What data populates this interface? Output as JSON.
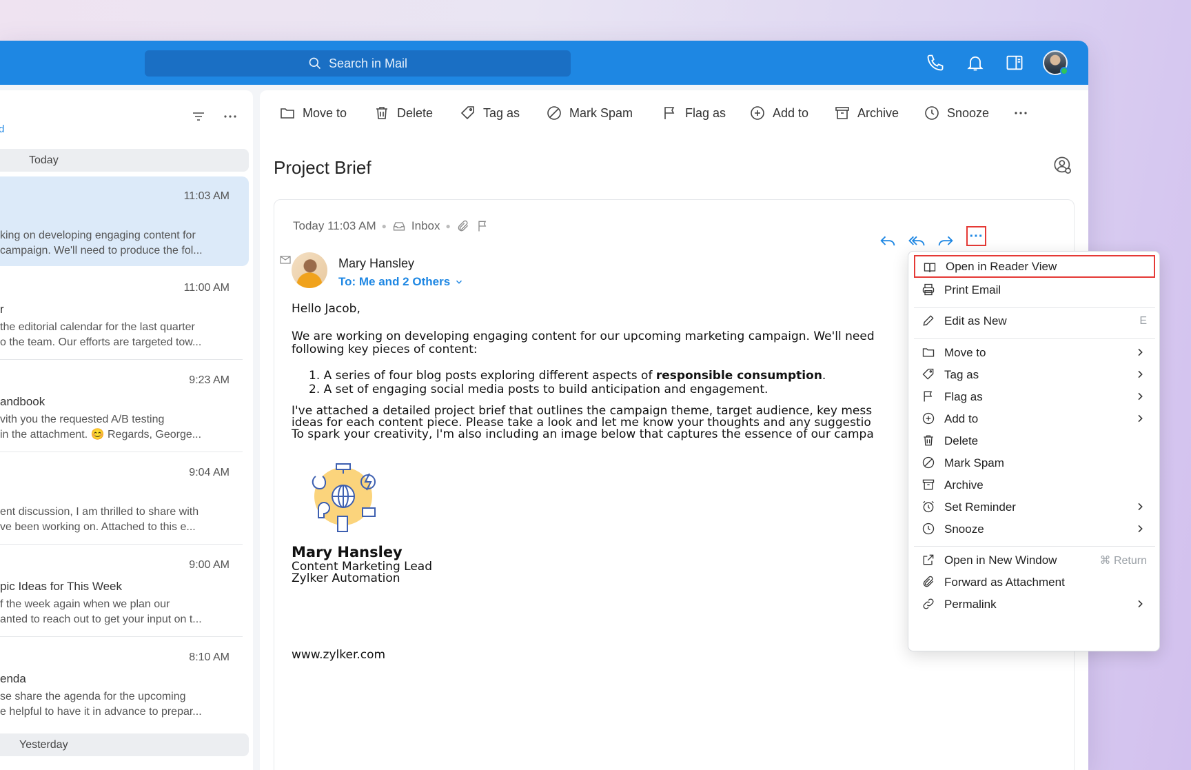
{
  "search": {
    "placeholder": "Search in Mail"
  },
  "list": {
    "link_fragment": "d",
    "groups": {
      "today": "Today",
      "yesterday": "Yesterday"
    },
    "items": [
      {
        "time": "11:03 AM",
        "subject": "",
        "preview1": "king on developing engaging content for",
        "preview2": "campaign. We'll need to produce the fol..."
      },
      {
        "time": "11:00 AM",
        "subject": "r",
        "preview1": "the editorial calendar for the last quarter",
        "preview2": "o the team. Our efforts are targeted tow..."
      },
      {
        "time": "9:23 AM",
        "subject": "andbook",
        "preview1": "vith you the requested A/B testing",
        "preview2": "in the attachment. 😊 Regards, George..."
      },
      {
        "time": "9:04 AM",
        "subject": "",
        "preview1": "ent discussion, I am thrilled to share with",
        "preview2": "ve been working on. Attached to this e..."
      },
      {
        "time": "9:00 AM",
        "subject": "pic Ideas for This Week",
        "preview1": "f the week again when we plan our",
        "preview2": "anted to reach out to get your input on t..."
      },
      {
        "time": "8:10 AM",
        "subject": "enda",
        "preview1": "se share the agenda for the upcoming",
        "preview2": "e helpful to have it in advance to prepar..."
      }
    ]
  },
  "toolbar": {
    "move_to": "Move to",
    "delete": "Delete",
    "tag_as": "Tag as",
    "mark_spam": "Mark Spam",
    "flag_as": "Flag as",
    "add_to": "Add to",
    "archive": "Archive",
    "snooze": "Snooze"
  },
  "email": {
    "subject": "Project Brief",
    "date": "Today 11:03 AM",
    "folder": "Inbox",
    "sender": "Mary Hansley",
    "to": "To: Me and 2 Others",
    "greeting": "Hello Jacob,",
    "para1_line1": "We are working on developing engaging content for our upcoming marketing campaign. We'll need",
    "para1_line2": "following key pieces of content:",
    "list1_prefix": "1.  A series of four blog posts exploring different aspects of ",
    "list1_bold": "responsible consumption",
    "list1_suffix": ".",
    "list2": "2.  A set of engaging social media posts to build anticipation and engagement.",
    "para2_line1": "I've attached a detailed project brief that outlines the campaign theme, target audience, key mess",
    "para2_line2": "ideas for each content piece. Please take a look and let me know your thoughts and any suggestio",
    "para2_line3": "To spark your creativity, I'm also including an image below that captures the essence of our campa",
    "sig_name": "Mary Hansley",
    "sig_title": "Content Marketing Lead",
    "sig_company": "Zylker Automation",
    "website": "www.zylker.com"
  },
  "menu": {
    "items": [
      {
        "label": "Open in Reader View"
      },
      {
        "label": "Print Email"
      },
      {
        "label": "Edit as New",
        "shortcut": "E"
      },
      {
        "label": "Move to"
      },
      {
        "label": "Tag as"
      },
      {
        "label": "Flag as"
      },
      {
        "label": "Add to"
      },
      {
        "label": "Delete"
      },
      {
        "label": "Mark Spam"
      },
      {
        "label": "Archive"
      },
      {
        "label": "Set Reminder"
      },
      {
        "label": "Snooze"
      },
      {
        "label": "Open in New Window",
        "shortcut": "⌘ Return"
      },
      {
        "label": "Forward as Attachment"
      },
      {
        "label": "Permalink"
      }
    ]
  },
  "colors": {
    "accent": "#1e87e3",
    "highlight_border": "#e53935",
    "selected_item": "#dceaf9"
  },
  "icons": [
    "search-icon",
    "phone-icon",
    "bell-icon",
    "reading-pane-icon",
    "filter-icon",
    "more-icon",
    "folder-icon",
    "trash-icon",
    "tag-icon",
    "spam-icon",
    "flag-icon",
    "add-circle-icon",
    "archive-icon",
    "clock-icon",
    "reply-icon",
    "reply-all-icon",
    "forward-icon",
    "reader-view-icon",
    "printer-icon",
    "pencil-icon",
    "chevron-right-icon",
    "alarm-icon",
    "external-window-icon",
    "paperclip-icon",
    "link-icon"
  ]
}
